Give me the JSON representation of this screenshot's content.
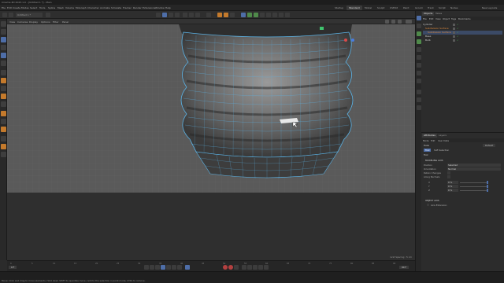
{
  "window": {
    "title": "Cinema 4D 2023.1.0 - [Untitled 1 *] - Main"
  },
  "menubar": {
    "items": [
      "File",
      "Edit",
      "Create",
      "Modes",
      "Select",
      "Tools",
      "Spline",
      "Mesh",
      "Volume",
      "MoGraph",
      "Character",
      "Animate",
      "Simulate",
      "Tracker",
      "Render",
      "Extensions",
      "Window",
      "Help"
    ],
    "layouts": [
      "Startup",
      "Standard",
      "Model",
      "Sculpt",
      "UVEdit",
      "Paint",
      "Groom",
      "Track",
      "Script",
      "Nodes"
    ],
    "active_layout": "Standard",
    "new_layouts": "New Layouts"
  },
  "toolbar": {
    "doc_tab": "Untitled 1 *"
  },
  "viewport": {
    "menu": [
      "View",
      "Cameras",
      "Display",
      "Options",
      "Filter",
      "Panel"
    ],
    "grid_spacing": "Grid Spacing : 5 cm"
  },
  "object_manager": {
    "tabs": [
      "Objects",
      "Takes"
    ],
    "menu": [
      "File",
      "Edit",
      "View",
      "Object",
      "Tags",
      "Bookmarks"
    ],
    "objects": [
      {
        "name": "Cylinder",
        "color": "#c8c8c8"
      },
      {
        "name": "Subdivision Surface",
        "color": "#e08a3c"
      },
      {
        "name": "Subdivision Surface",
        "color": "#e08a3c"
      },
      {
        "name": "Base",
        "color": "#c8c8c8"
      },
      {
        "name": "Bulb",
        "color": "#c8c8c8"
      }
    ]
  },
  "attribute_manager": {
    "tabs": [
      "Attributes",
      "Layers"
    ],
    "menu": [
      "Mode",
      "Edit",
      "User Data"
    ],
    "mode_label": "Tools",
    "default_label": "Default",
    "sub_tabs": [
      "Tool",
      "Soft Selection"
    ],
    "section_label": "Tool",
    "section_header": "MODELING AXIS",
    "rows": [
      {
        "label": "Position",
        "value": "Selected"
      },
      {
        "label": "Orientation",
        "value": "Normal"
      },
      {
        "label": "Retain Changes",
        "value": ""
      },
      {
        "label": "Along Normals",
        "value": ""
      },
      {
        "label": "X",
        "value": "0 %"
      },
      {
        "label": "Y",
        "value": "0 %"
      },
      {
        "label": "Z",
        "value": "0 %"
      }
    ],
    "object_axis": "OBJECT AXIS",
    "axis_extension": "Axis Extension"
  },
  "timeline": {
    "ticks": [
      "0",
      "5",
      "10",
      "15",
      "20",
      "25",
      "30",
      "35",
      "40",
      "45",
      "50",
      "55",
      "60",
      "65",
      "70",
      "75",
      "80",
      "85",
      "90"
    ],
    "current_frame": "0 F",
    "end_frame": "90 F"
  },
  "statusbar": {
    "text": "Move: Click and drag to move elements. Hold down SHIFT to quantize move / add to the selection in point mode, CTRL to remove."
  },
  "colors": {
    "accent_blue": "#4e6ea8",
    "wire_blue": "#5bb3e6",
    "orange": "#e08a3c"
  }
}
